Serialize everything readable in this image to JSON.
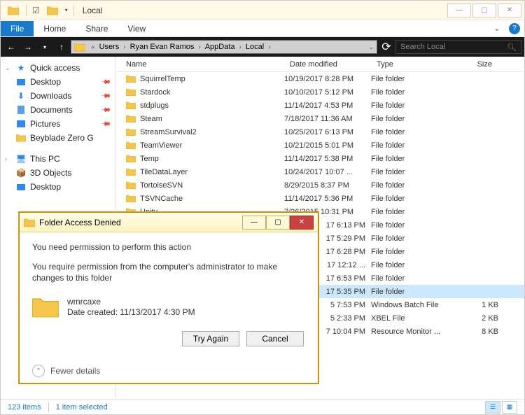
{
  "window_title": "Local",
  "menu": {
    "file": "File",
    "home": "Home",
    "share": "Share",
    "view": "View"
  },
  "breadcrumb": [
    "Users",
    "Ryan Evan Ramos",
    "AppData",
    "Local"
  ],
  "search_placeholder": "Search Local",
  "nav": {
    "quick_access": "Quick access",
    "desktop": "Desktop",
    "downloads": "Downloads",
    "documents": "Documents",
    "pictures": "Pictures",
    "beyblade": "Beyblade Zero G",
    "this_pc": "This PC",
    "objects3d": "3D Objects",
    "desktop2": "Desktop"
  },
  "columns": {
    "name": "Name",
    "date": "Date modified",
    "type": "Type",
    "size": "Size"
  },
  "rows": [
    {
      "name": "SquirrelTemp",
      "date": "10/19/2017 8:28 PM",
      "type": "File folder",
      "size": "",
      "icon": "folder"
    },
    {
      "name": "Stardock",
      "date": "10/10/2017 5:12 PM",
      "type": "File folder",
      "size": "",
      "icon": "folder"
    },
    {
      "name": "stdplugs",
      "date": "11/14/2017 4:53 PM",
      "type": "File folder",
      "size": "",
      "icon": "folder"
    },
    {
      "name": "Steam",
      "date": "7/18/2017 11:36 AM",
      "type": "File folder",
      "size": "",
      "icon": "folder"
    },
    {
      "name": "StreamSurvival2",
      "date": "10/25/2017 6:13 PM",
      "type": "File folder",
      "size": "",
      "icon": "folder"
    },
    {
      "name": "TeamViewer",
      "date": "10/21/2015 5:01 PM",
      "type": "File folder",
      "size": "",
      "icon": "folder"
    },
    {
      "name": "Temp",
      "date": "11/14/2017 5:38 PM",
      "type": "File folder",
      "size": "",
      "icon": "folder"
    },
    {
      "name": "TileDataLayer",
      "date": "10/24/2017 10:07 ...",
      "type": "File folder",
      "size": "",
      "icon": "folder"
    },
    {
      "name": "TortoiseSVN",
      "date": "8/29/2015 8:37 PM",
      "type": "File folder",
      "size": "",
      "icon": "folder"
    },
    {
      "name": "TSVNCache",
      "date": "11/14/2017 5:36 PM",
      "type": "File folder",
      "size": "",
      "icon": "folder"
    },
    {
      "name": "Unity",
      "date": "7/26/2015 10:31 PM",
      "type": "File folder",
      "size": "",
      "icon": "folder"
    },
    {
      "name": "",
      "date": "17 6:13 PM",
      "type": "File folder",
      "size": "",
      "icon": "folder",
      "obscured": true
    },
    {
      "name": "",
      "date": "17 5:29 PM",
      "type": "File folder",
      "size": "",
      "icon": "folder",
      "obscured": true
    },
    {
      "name": "",
      "date": "17 6:28 PM",
      "type": "File folder",
      "size": "",
      "icon": "folder",
      "obscured": true
    },
    {
      "name": "",
      "date": "17 12:12 ...",
      "type": "File folder",
      "size": "",
      "icon": "folder",
      "obscured": true
    },
    {
      "name": "",
      "date": "17 6:53 PM",
      "type": "File folder",
      "size": "",
      "icon": "folder",
      "obscured": true
    },
    {
      "name": "",
      "date": "17 5:35 PM",
      "type": "File folder",
      "size": "",
      "icon": "folder",
      "obscured": true,
      "selected": true
    },
    {
      "name": "",
      "date": "5 7:53 PM",
      "type": "Windows Batch File",
      "size": "1 KB",
      "icon": "file",
      "obscured": true
    },
    {
      "name": "",
      "date": "5 2:33 PM",
      "type": "XBEL File",
      "size": "2 KB",
      "icon": "file",
      "obscured": true
    },
    {
      "name": "",
      "date": "7 10:04 PM",
      "type": "Resource Monitor ...",
      "size": "8 KB",
      "icon": "file",
      "obscured": true
    }
  ],
  "status": {
    "items": "123 items",
    "selected": "1 item selected"
  },
  "dialog": {
    "title": "Folder Access Denied",
    "msg1": "You need permission to perform this action",
    "msg2": "You require permission from the computer's administrator to make changes to this folder",
    "item_name": "wmrcaxe",
    "item_meta": "Date created: 11/13/2017 4:30 PM",
    "try_again": "Try Again",
    "cancel": "Cancel",
    "fewer": "Fewer details"
  }
}
